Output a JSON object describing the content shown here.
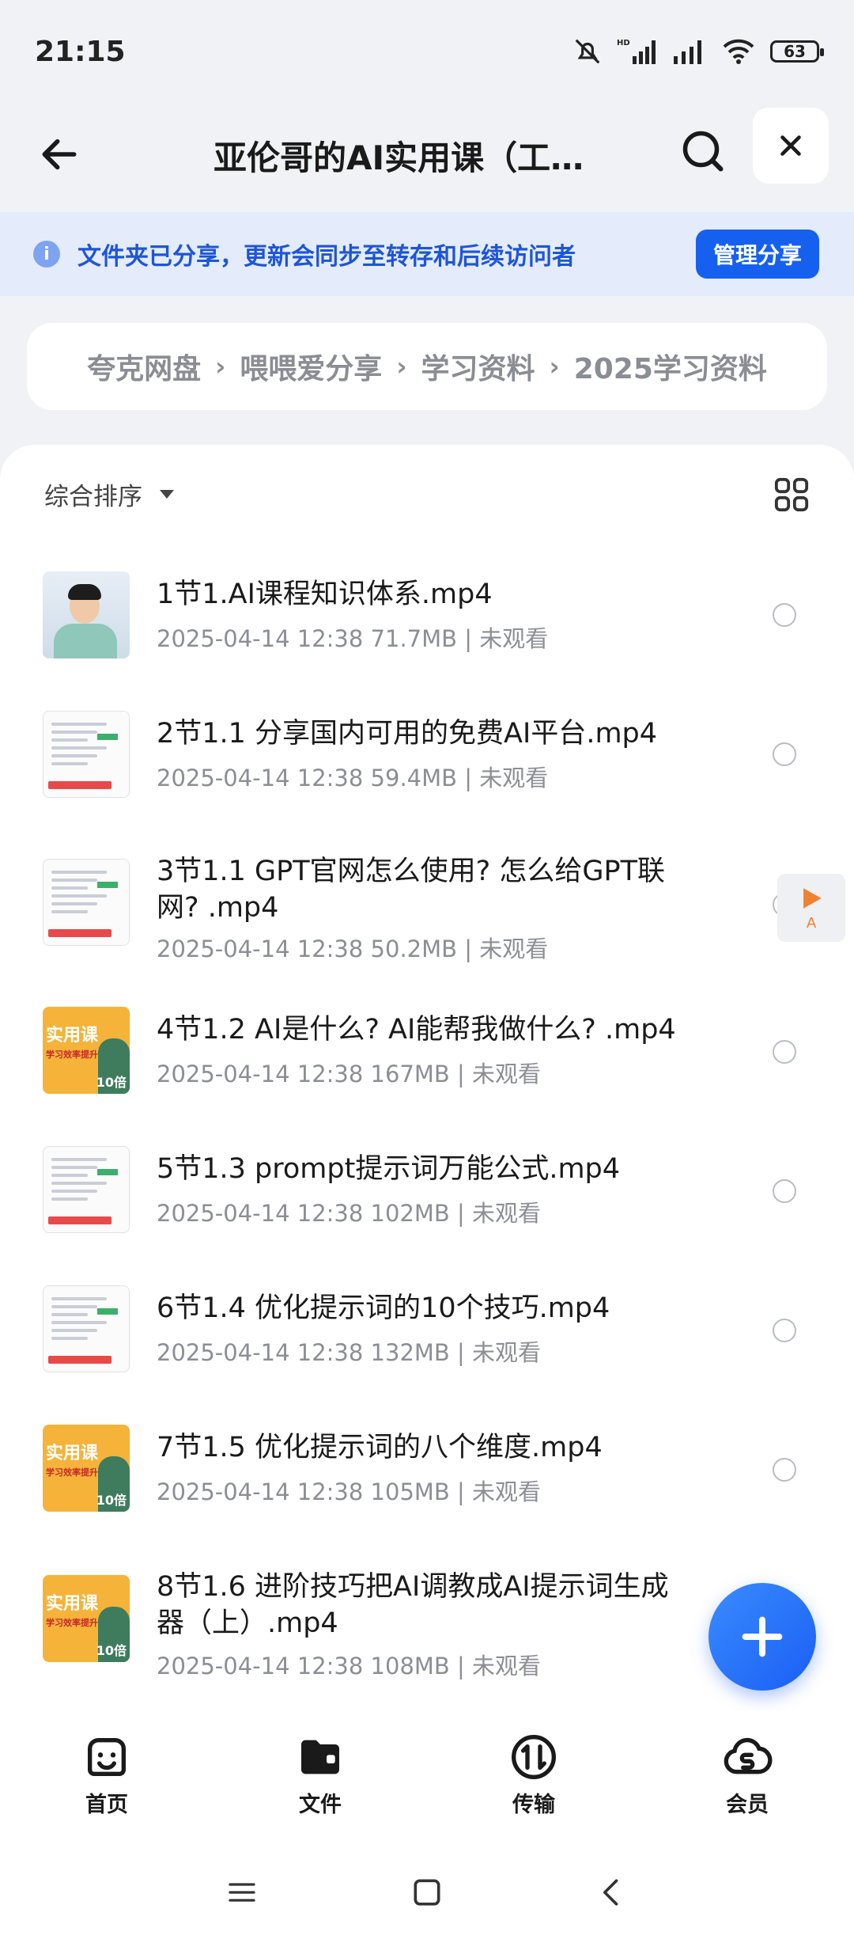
{
  "status_bar": {
    "time": "21:15",
    "battery": "63",
    "hd_label": "HD"
  },
  "header": {
    "title": "亚伦哥的AI实用课（工…"
  },
  "share_banner": {
    "text": "文件夹已分享，更新会同步至转存和后续访问者",
    "info_glyph": "i",
    "manage_label": "管理分享"
  },
  "breadcrumb": {
    "items": [
      "夸克网盘",
      "喂喂爱分享",
      "学习资料",
      "2025学习资料"
    ],
    "separator": "›"
  },
  "sort": {
    "label": "综合排序"
  },
  "files": [
    {
      "name": "1节1.AI课程知识体系.mp4",
      "meta": "2025-04-14 12:38  71.7MB | 未观看",
      "thumb": "person"
    },
    {
      "name": "2节1.1 分享国内可用的免费AI平台.mp4",
      "meta": "2025-04-14 12:38  59.4MB | 未观看",
      "thumb": "doc"
    },
    {
      "name": "3节1.1 GPT官网怎么使用? 怎么给GPT联网? .mp4",
      "meta": "2025-04-14 12:38  50.2MB | 未观看",
      "thumb": "doc"
    },
    {
      "name": "4节1.2 AI是什么? AI能帮我做什么? .mp4",
      "meta": "2025-04-14 12:38  167MB | 未观看",
      "thumb": "orange"
    },
    {
      "name": "5节1.3 prompt提示词万能公式.mp4",
      "meta": "2025-04-14 12:38  102MB | 未观看",
      "thumb": "doc"
    },
    {
      "name": "6节1.4 优化提示词的10个技巧.mp4",
      "meta": "2025-04-14 12:38  132MB | 未观看",
      "thumb": "doc"
    },
    {
      "name": "7节1.5 优化提示词的八个维度.mp4",
      "meta": "2025-04-14 12:38  105MB | 未观看",
      "thumb": "orange"
    },
    {
      "name": "8节1.6 进阶技巧把AI调教成AI提示词生成器（上）.mp4",
      "meta": "2025-04-14 12:38  108MB | 未观看",
      "thumb": "orange"
    }
  ],
  "thumb_text": {
    "course_title": "实用课",
    "course_sub": "学习效率提升",
    "badge": "10倍"
  },
  "float_play": {
    "letter": "A"
  },
  "bottom_nav": [
    {
      "label": "首页",
      "icon": "smile-face-icon"
    },
    {
      "label": "文件",
      "icon": "folder-icon"
    },
    {
      "label": "传输",
      "icon": "transfer-icon"
    },
    {
      "label": "会员",
      "icon": "vip-icon"
    }
  ],
  "colors": {
    "accent": "#1660f0",
    "banner_bg": "#e4ecfb",
    "banner_text": "#1e55d8",
    "meta_gray": "#8b8e94"
  }
}
